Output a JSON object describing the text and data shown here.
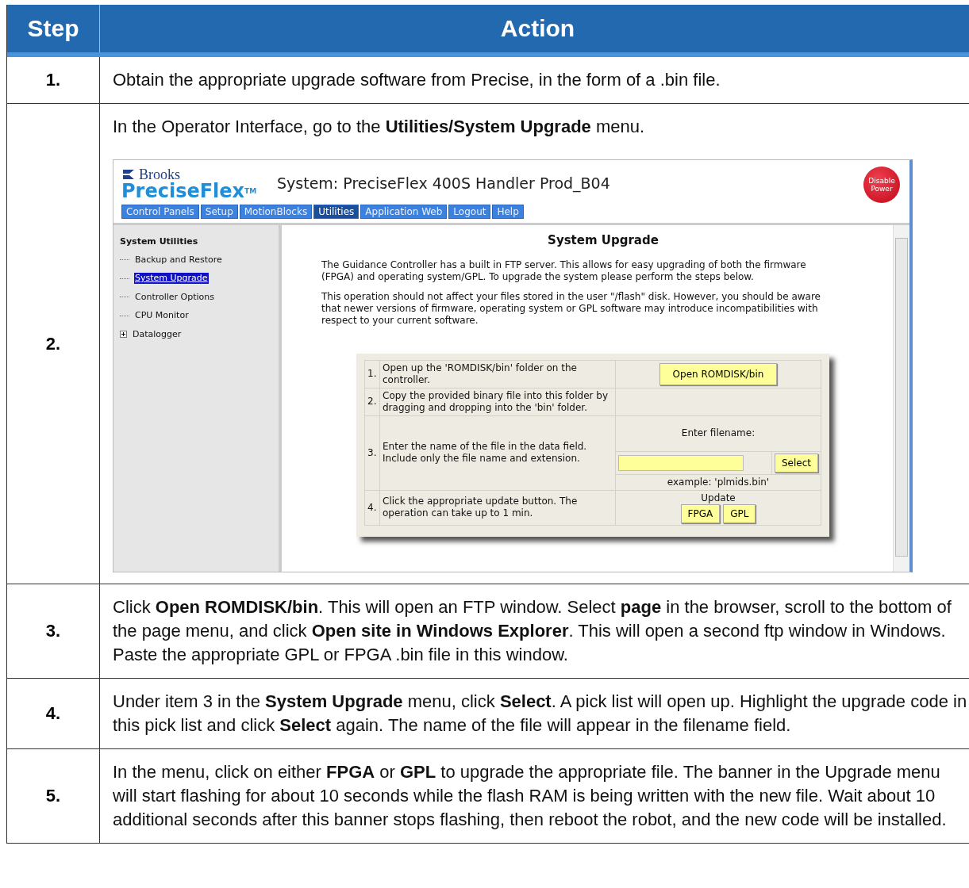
{
  "table": {
    "columns": [
      "Step",
      "Action"
    ],
    "rows": [
      {
        "step": "1.",
        "text": "Obtain the appropriate upgrade software from Precise, in the form of a .bin file."
      },
      {
        "step": "2.",
        "text": "In the Operator Interface, go to the **Utilities/System Upgrade** menu.",
        "screenshot": {
          "brand": "Brooks",
          "product": "PreciseFlex",
          "trademark": "TM",
          "title": "System: PreciseFlex 400S Handler Prod_B04",
          "power_button": "Disable Power",
          "nav": [
            {
              "label": "Control Panels",
              "selected": false
            },
            {
              "label": "Setup",
              "selected": false
            },
            {
              "label": "MotionBlocks",
              "selected": false
            },
            {
              "label": "Utilities",
              "selected": true
            },
            {
              "label": "Application Web",
              "selected": false
            },
            {
              "label": "Logout",
              "selected": false
            },
            {
              "label": "Help",
              "selected": false
            }
          ],
          "sidebar": {
            "heading": "System Utilities",
            "items": [
              {
                "label": "Backup and Restore",
                "selected": false,
                "kind": "leaf"
              },
              {
                "label": "System Upgrade",
                "selected": true,
                "kind": "leaf"
              },
              {
                "label": "Controller Options",
                "selected": false,
                "kind": "leaf"
              },
              {
                "label": "CPU Monitor",
                "selected": false,
                "kind": "leaf"
              },
              {
                "label": "Datalogger",
                "selected": false,
                "kind": "folder",
                "expanded": false
              }
            ]
          },
          "panel": {
            "title": "System Upgrade",
            "paragraphs": [
              "The Guidance Controller has a built in FTP server. This allows for easy upgrading of both the firmware (FPGA) and operating system/GPL. To upgrade the system please perform the steps below.",
              "This operation should not affect your files stored in the user \"/flash\" disk.  However, you should be aware that newer versions of firmware, operating system or GPL software may introduce incompatibilities with respect to your current software."
            ],
            "steps": [
              {
                "number": "1.",
                "text": "Open up the 'ROMDISK/bin' folder on the controller.",
                "kind": "button",
                "button": "Open ROMDISK/bin"
              },
              {
                "number": "2.",
                "text": "Copy the provided binary file into this folder by dragging and dropping into the 'bin' folder.",
                "kind": "none"
              },
              {
                "number": "3.",
                "text": "Enter the name of the file in the data field. Include only the file name and extension.",
                "kind": "filename",
                "label": "Enter filename:",
                "button": "Select",
                "example": "example: 'plmids.bin'"
              },
              {
                "number": "4.",
                "text": "Click the appropriate update button. The operation can take up to 1 min.",
                "kind": "update",
                "label": "Update",
                "buttons": [
                  "FPGA",
                  "GPL"
                ]
              }
            ]
          }
        }
      },
      {
        "step": "3.",
        "text": "Click **Open ROMDISK/bin**. This will open an FTP window. Select **page** in the browser, scroll to the bottom of the page menu, and click **Open site in Windows Explorer**. This will open a second ftp window in Windows. Paste the appropriate GPL or FPGA .bin file in this window."
      },
      {
        "step": "4.",
        "text": "Under item 3 in the **System Upgrade** menu, click **Select**. A pick list will open up. Highlight the upgrade code in this pick list and click **Select** again. The name of the file will appear in the filename field."
      },
      {
        "step": "5.",
        "text": "In the menu, click on either **FPGA** or **GPL** to upgrade the appropriate file. The banner in the Upgrade menu will start flashing for about 10 seconds while the flash RAM is being written with the new file. Wait about 10 additional seconds after this banner stops flashing, then reboot the robot, and the new code will be installed."
      }
    ]
  }
}
